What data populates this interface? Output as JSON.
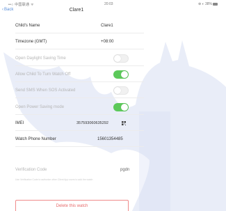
{
  "statusbar": {
    "carrier": "••○ 中国联通 ᯤ",
    "time": "20:03",
    "battery": "⊕ ◐ 38%"
  },
  "navbar": {
    "back_label": "Back",
    "title": "Clare1"
  },
  "settings": {
    "childs_name": {
      "label": "Child's Name",
      "value": "Clare1"
    },
    "timezone": {
      "label": "Timezone (GMT)",
      "value": "+08:00"
    },
    "daylight_saving": {
      "label": "Open Daylight Saving Time",
      "on": false
    },
    "turn_watch_off": {
      "label": "Allow Child To Turn Watch Off",
      "on": true
    },
    "sos_sms": {
      "label": "Send SMS When SOS Activated",
      "on": false
    },
    "power_saving": {
      "label": "Open Power Saving mode",
      "on": true
    },
    "imei": {
      "label": "IMEI",
      "value": "357593060635292"
    },
    "watch_phone": {
      "label": "Watch Phone Number",
      "value": "15601354485"
    },
    "verification": {
      "label": "Verification Code",
      "value": "pgdn"
    },
    "hint": "Use Verification Code to authorize other Client App users to add the watch"
  },
  "actions": {
    "delete_label": "Delete this watch"
  },
  "colors": {
    "toggle_on": "#5cc95a",
    "link_blue": "#5a8fd9",
    "danger": "#e66a6a",
    "watermark": "#d7def3"
  },
  "icons": [
    "chevron-left-icon",
    "qr-code-icon",
    "bat-watermark"
  ]
}
